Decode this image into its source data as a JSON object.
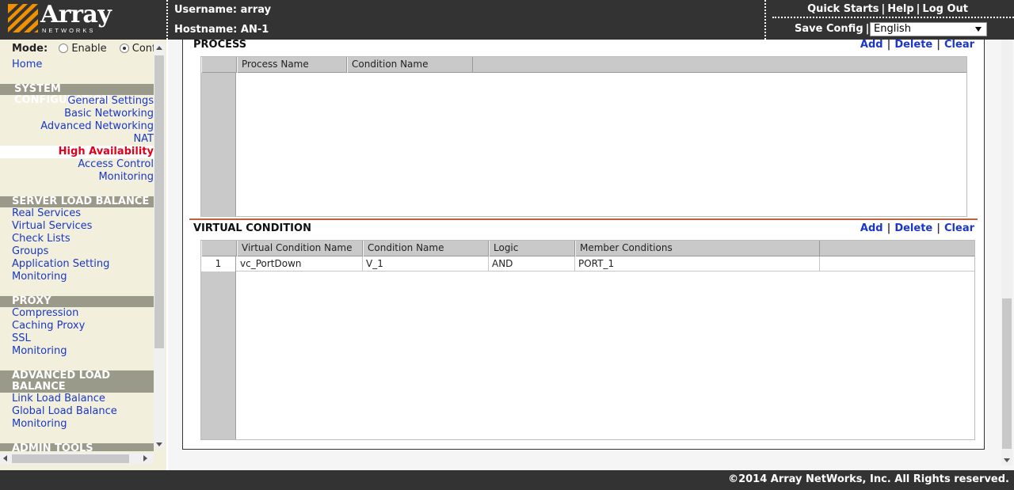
{
  "header": {
    "logo_text": "Array",
    "logo_subtext": "NETWORKS",
    "username_label": "Username: array",
    "hostname_label": "Hostname: AN-1",
    "links": {
      "quick_starts": "Quick Starts",
      "help": "Help",
      "log_out": "Log Out",
      "save_config": "Save Config"
    },
    "separator": "|",
    "language": "English"
  },
  "sidebar": {
    "mode_label": "Mode:",
    "mode_enable": "Enable",
    "mode_config": "Config",
    "home": "Home",
    "system_configuration": {
      "title": "SYSTEM CONFIGURATION",
      "items": [
        "General Settings",
        "Basic Networking",
        "Advanced Networking",
        "NAT",
        "High Availability",
        "Access Control",
        "Monitoring"
      ],
      "active": "High Availability"
    },
    "server_load_balance": {
      "title": "SERVER LOAD BALANCE",
      "items": [
        "Real Services",
        "Virtual Services",
        "Check Lists",
        "Groups",
        "Application Setting",
        "Monitoring"
      ]
    },
    "proxy": {
      "title": "PROXY",
      "items": [
        "Compression",
        "Caching Proxy",
        "SSL",
        "Monitoring"
      ]
    },
    "advanced_load_balance": {
      "title_line1": "ADVANCED LOAD",
      "title_line2": "BALANCE",
      "items": [
        "Link Load Balance",
        "Global Load Balance",
        "Monitoring"
      ]
    },
    "admin_tools": {
      "title": "ADMIN TOOLS"
    }
  },
  "process": {
    "title": "PROCESS",
    "actions": {
      "add": "Add",
      "delete": "Delete",
      "clear": "Clear"
    },
    "columns": [
      "Process Name",
      "Condition Name"
    ],
    "rows": []
  },
  "virtual_condition": {
    "title": "VIRTUAL CONDITION",
    "actions": {
      "add": "Add",
      "delete": "Delete",
      "clear": "Clear"
    },
    "columns": [
      "Virtual Condition Name",
      "Condition Name",
      "Logic",
      "Member Conditions"
    ],
    "rows": [
      {
        "num": "1",
        "virtual_condition_name": "vc_PortDown",
        "condition_name": "V_1",
        "logic": "AND",
        "member_conditions": "PORT_1"
      }
    ]
  },
  "footer": {
    "copyright": "©2014 Array NetWorks, Inc. All Rights reserved."
  },
  "colors": {
    "header_bg": "#333333",
    "sidebar_bg": "#f2f0dc",
    "link": "#1a37c8",
    "active_link": "#e0001a",
    "section_bg": "#9a9a8a",
    "logo_orange": "#f29100"
  }
}
